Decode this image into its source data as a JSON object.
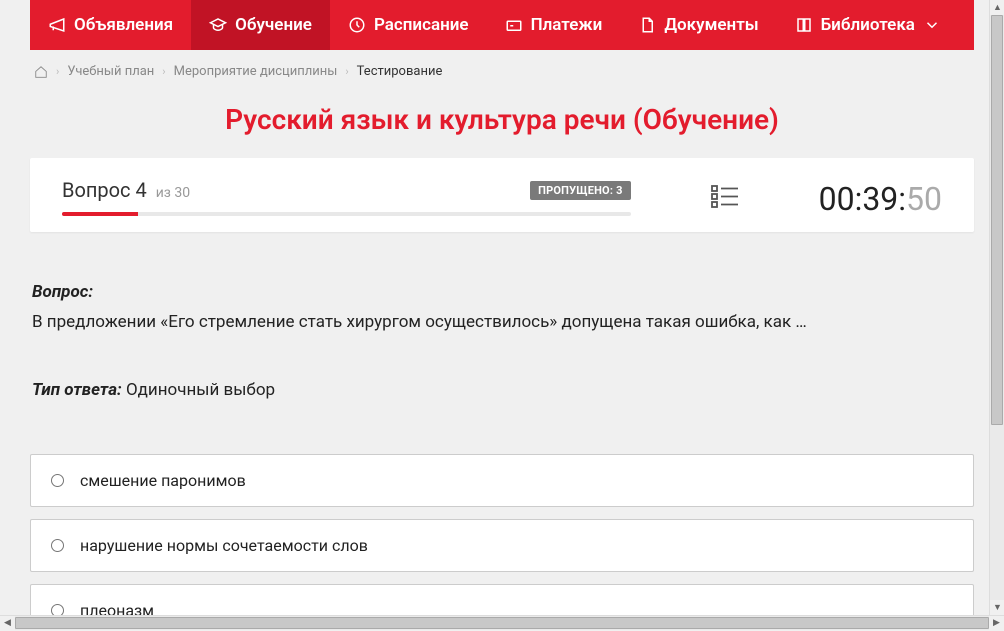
{
  "nav": {
    "items": [
      {
        "label": "Объявления",
        "active": false
      },
      {
        "label": "Обучение",
        "active": true
      },
      {
        "label": "Расписание",
        "active": false
      },
      {
        "label": "Платежи",
        "active": false
      },
      {
        "label": "Документы",
        "active": false
      },
      {
        "label": "Библиотека",
        "active": false
      }
    ]
  },
  "breadcrumb": {
    "items": [
      "Учебный план",
      "Мероприятие дисциплины"
    ],
    "current": "Тестирование"
  },
  "page_title": "Русский язык и культура речи (Обучение)",
  "quiz": {
    "question_word": "Вопрос",
    "question_num": "4",
    "of_word": "из",
    "total": "30",
    "skipped_label": "ПРОПУЩЕНО: 3",
    "progress_percent": 13.3,
    "timer_main": "00:39:",
    "timer_sec": "50"
  },
  "question": {
    "heading": "Вопрос:",
    "text": "В предложении «Его стремление стать хирургом осуществилось» допущена такая ошибка, как …"
  },
  "answer_type": {
    "label": "Тип ответа:",
    "value": "Одиночный выбор"
  },
  "options": [
    {
      "text": "смешение паронимов"
    },
    {
      "text": "нарушение нормы сочетаемости слов"
    },
    {
      "text": "плеоназм"
    }
  ]
}
